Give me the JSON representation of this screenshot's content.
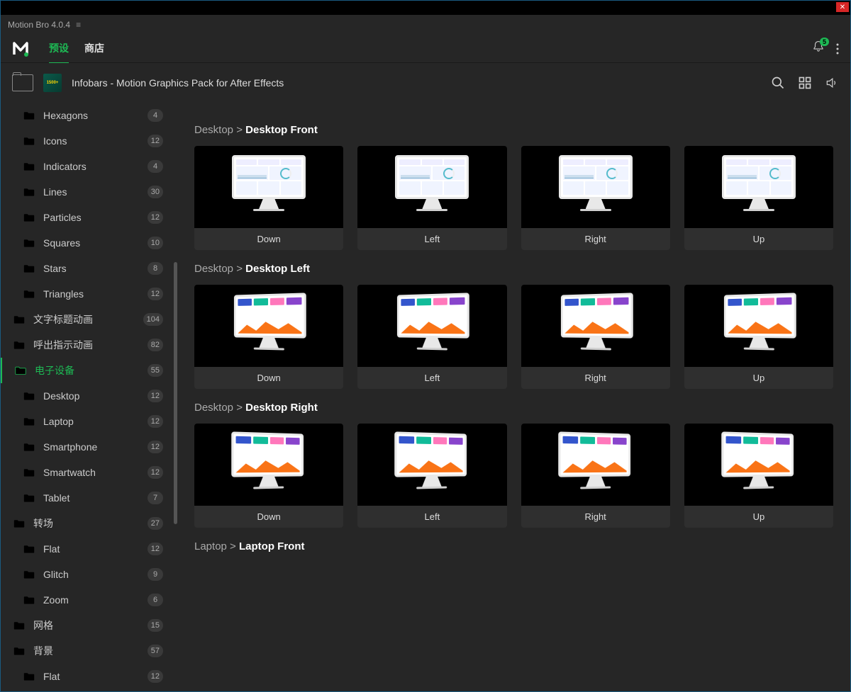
{
  "titleBar": {
    "title": "Motion Bro 4.0.4"
  },
  "tabs": {
    "presets": "预设",
    "store": "商店"
  },
  "notifications": {
    "count": "5"
  },
  "pack": {
    "title": "Infobars - Motion Graphics Pack for After Effects",
    "iconLabel": "1500+"
  },
  "sidebar": {
    "items": [
      {
        "label": "Hexagons",
        "count": "4",
        "level": "sub"
      },
      {
        "label": "Icons",
        "count": "12",
        "level": "sub"
      },
      {
        "label": "Indicators",
        "count": "4",
        "level": "sub"
      },
      {
        "label": "Lines",
        "count": "30",
        "level": "sub"
      },
      {
        "label": "Particles",
        "count": "12",
        "level": "sub"
      },
      {
        "label": "Squares",
        "count": "10",
        "level": "sub"
      },
      {
        "label": "Stars",
        "count": "8",
        "level": "sub"
      },
      {
        "label": "Triangles",
        "count": "12",
        "level": "sub"
      },
      {
        "label": "文字标题动画",
        "count": "104",
        "level": "top"
      },
      {
        "label": "呼出指示动画",
        "count": "82",
        "level": "top"
      },
      {
        "label": "电子设备",
        "count": "55",
        "level": "top",
        "active": true
      },
      {
        "label": "Desktop",
        "count": "12",
        "level": "sub"
      },
      {
        "label": "Laptop",
        "count": "12",
        "level": "sub"
      },
      {
        "label": "Smartphone",
        "count": "12",
        "level": "sub"
      },
      {
        "label": "Smartwatch",
        "count": "12",
        "level": "sub"
      },
      {
        "label": "Tablet",
        "count": "7",
        "level": "sub"
      },
      {
        "label": "转场",
        "count": "27",
        "level": "top"
      },
      {
        "label": "Flat",
        "count": "12",
        "level": "sub"
      },
      {
        "label": "Glitch",
        "count": "9",
        "level": "sub"
      },
      {
        "label": "Zoom",
        "count": "6",
        "level": "sub"
      },
      {
        "label": "网格",
        "count": "15",
        "level": "top"
      },
      {
        "label": "背景",
        "count": "57",
        "level": "top"
      },
      {
        "label": "Flat",
        "count": "12",
        "level": "sub"
      }
    ]
  },
  "sections": [
    {
      "crumb": "Desktop",
      "name": "Desktop Front",
      "style": "front",
      "angle": "none",
      "items": [
        {
          "label": "Down"
        },
        {
          "label": "Left"
        },
        {
          "label": "Right"
        },
        {
          "label": "Up"
        }
      ]
    },
    {
      "crumb": "Desktop",
      "name": "Desktop Left",
      "style": "colorful",
      "angle": "left",
      "items": [
        {
          "label": "Down"
        },
        {
          "label": "Left"
        },
        {
          "label": "Right"
        },
        {
          "label": "Up"
        }
      ]
    },
    {
      "crumb": "Desktop",
      "name": "Desktop Right",
      "style": "colorful",
      "angle": "right",
      "items": [
        {
          "label": "Down"
        },
        {
          "label": "Left"
        },
        {
          "label": "Right"
        },
        {
          "label": "Up"
        }
      ]
    },
    {
      "crumb": "Laptop",
      "name": "Laptop Front",
      "style": "front",
      "angle": "none",
      "items": []
    }
  ]
}
